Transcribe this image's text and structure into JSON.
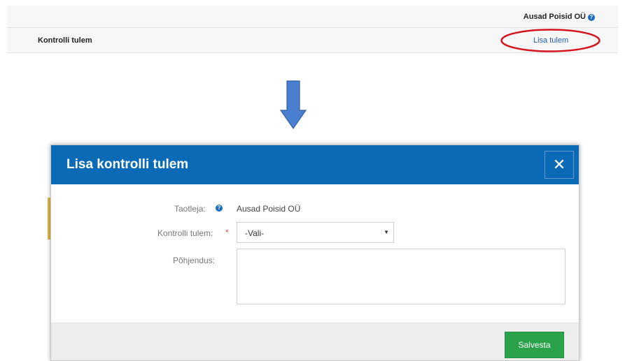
{
  "top": {
    "company_name": "Ausad Poisid OÜ",
    "result_label": "Kontrolli tulem",
    "add_result_link": "Lisa tulem"
  },
  "modal": {
    "title": "Lisa kontrolli tulem",
    "close_symbol": "✕",
    "applicant_label": "Taotleja:",
    "applicant_value": "Ausad Poisid OÜ",
    "control_result_label": "Kontrolli tulem:",
    "control_result_required": "*",
    "control_result_value": "-Vali-",
    "reason_label": "Põhjendus:",
    "reason_value": "",
    "save_label": "Salvesta"
  },
  "colors": {
    "header_blue": "#0a6ab5",
    "link_blue": "#1f5fb3",
    "save_green": "#2aa24a",
    "highlight_red": "#d3141c",
    "arrow_blue": "#4a7fcf"
  },
  "icons": {
    "help": "help-icon",
    "arrow": "down-arrow-icon",
    "caret": "caret-down-icon",
    "close": "close-icon"
  }
}
